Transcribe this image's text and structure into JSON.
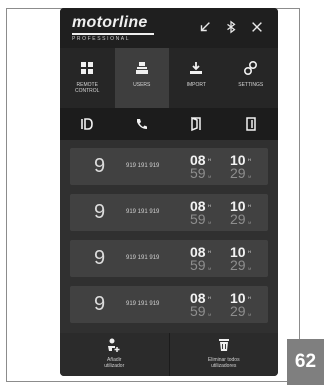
{
  "app": {
    "logo": "motorline",
    "logo_sub": "PROFESSIONAL"
  },
  "header_icons": [
    "minimize-icon",
    "bluetooth-icon",
    "close-icon"
  ],
  "tabs": [
    {
      "label": "REMOTE\nCONTROL",
      "icon": "grid-icon",
      "active": false
    },
    {
      "label": "USERS",
      "icon": "users-icon",
      "active": true
    },
    {
      "label": "IMPORT",
      "icon": "import-icon",
      "active": false
    },
    {
      "label": "SETTINGS",
      "icon": "gears-icon",
      "active": false
    }
  ],
  "subbar": [
    "id-card-icon",
    "phone-icon",
    "door-open-icon",
    "door-icon"
  ],
  "users": [
    {
      "id": "9",
      "phone": "919 191 919",
      "start_h": "08",
      "start_m": "59",
      "end_h": "10",
      "end_m": "29",
      "h_unit": "H",
      "m_unit": "M"
    },
    {
      "id": "9",
      "phone": "919 191 919",
      "start_h": "08",
      "start_m": "59",
      "end_h": "10",
      "end_m": "29",
      "h_unit": "H",
      "m_unit": "M"
    },
    {
      "id": "9",
      "phone": "919 191 919",
      "start_h": "08",
      "start_m": "59",
      "end_h": "10",
      "end_m": "29",
      "h_unit": "H",
      "m_unit": "M"
    },
    {
      "id": "9",
      "phone": "919 191 919",
      "start_h": "08",
      "start_m": "59",
      "end_h": "10",
      "end_m": "29",
      "h_unit": "H",
      "m_unit": "M"
    }
  ],
  "footer": {
    "add_label": "Añadir\nutilizador",
    "delete_label": "Eliminar todos\nutilizadores"
  },
  "page_number": "62"
}
